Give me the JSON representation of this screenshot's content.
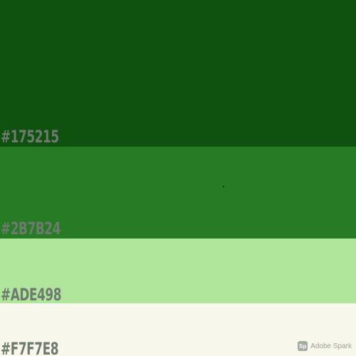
{
  "palette": {
    "swatches": [
      {
        "hex_label": "#175215",
        "color": "#0f510f"
      },
      {
        "hex_label": "#2B7B24",
        "color": "#267b24"
      },
      {
        "hex_label": "#ADE498",
        "color": "#b0e59c"
      },
      {
        "hex_label": "#F7F7E8",
        "color": "#f7f7eb"
      }
    ]
  },
  "watermark": {
    "logo_text": "Sp",
    "brand_text": "Adobe Spark"
  }
}
